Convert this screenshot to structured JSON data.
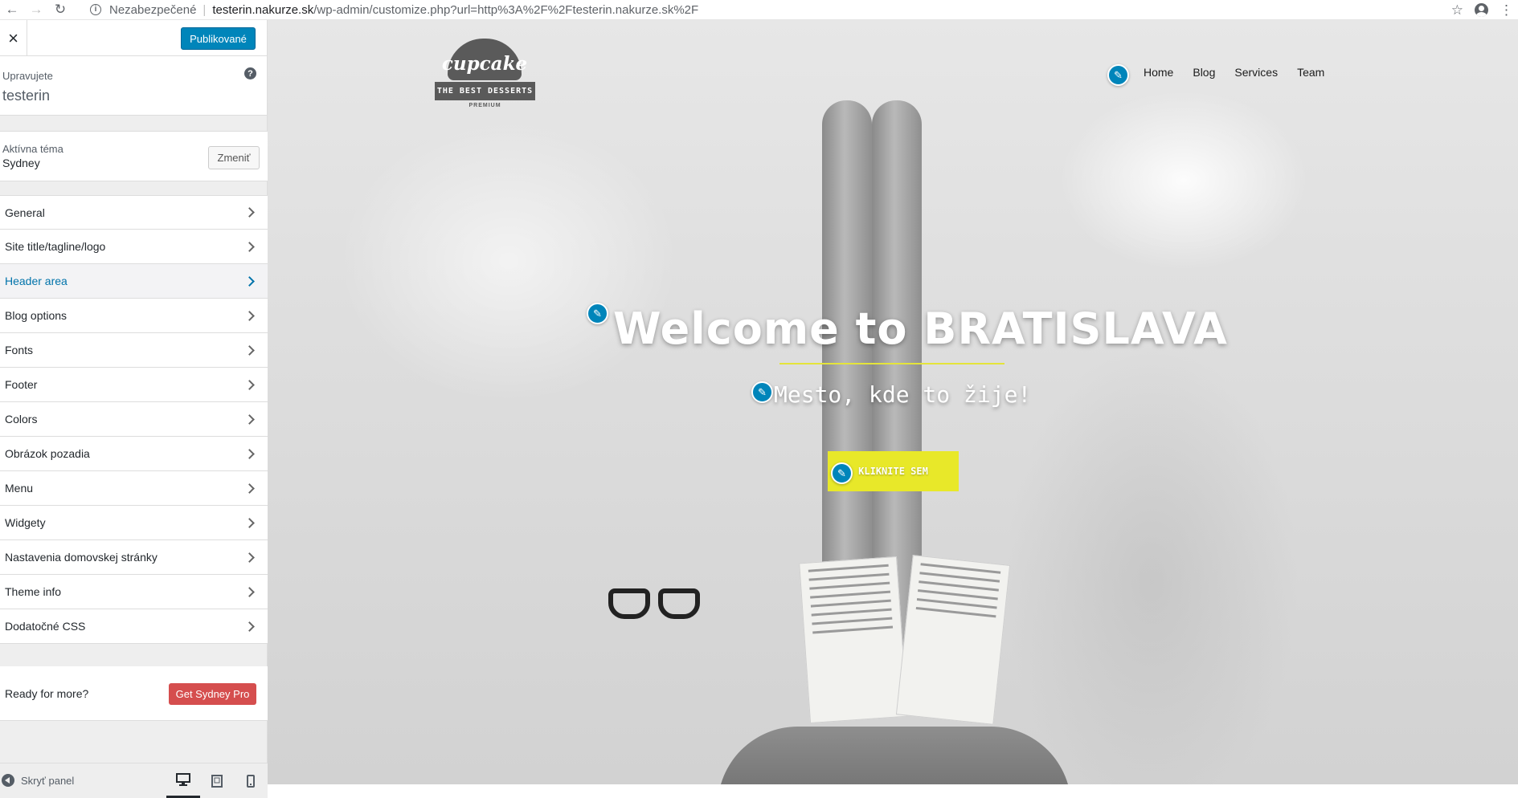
{
  "browser": {
    "security_label": "Nezabezpečené",
    "url_domain": "testerin.nakurze.sk",
    "url_path": "/wp-admin/customize.php?url=http%3A%2F%2Ftesterin.nakurze.sk%2F"
  },
  "customizer": {
    "close_label": "×",
    "publish_label": "Publikované",
    "editing_label": "Upravujete",
    "site_name": "testerin",
    "help_label": "?",
    "theme_label": "Aktívna téma",
    "theme_name": "Sydney",
    "change_label": "Zmeniť",
    "menu": [
      {
        "label": "General"
      },
      {
        "label": "Site title/tagline/logo"
      },
      {
        "label": "Header area"
      },
      {
        "label": "Blog options"
      },
      {
        "label": "Fonts"
      },
      {
        "label": "Footer"
      },
      {
        "label": "Colors"
      },
      {
        "label": "Obrázok pozadia"
      },
      {
        "label": "Menu"
      },
      {
        "label": "Widgety"
      },
      {
        "label": "Nastavenia domovskej stránky"
      },
      {
        "label": "Theme info"
      },
      {
        "label": "Dodatočné CSS"
      }
    ],
    "active_item": "Header area",
    "upsell_text": "Ready for more?",
    "upsell_button": "Get Sydney Pro",
    "collapse_label": "Skryť panel"
  },
  "site": {
    "logo": {
      "script": "cupcake",
      "band": "THE BEST DESSERTS",
      "sub": "PREMIUM"
    },
    "nav": [
      "Home",
      "Blog",
      "Services",
      "Team"
    ],
    "hero_title": "Welcome to BRATISLAVA",
    "hero_subtitle": "Mesto, kde to žije!",
    "hero_button": "KLIKNITE SEM"
  },
  "colors": {
    "publish": "#0085ba",
    "active_menu": "#0073aa",
    "pro_button": "#d54e4e",
    "hero_button": "#e8e829",
    "hero_rule": "#e4e43a"
  },
  "icons": {
    "back": "arrow-left-icon",
    "forward": "arrow-right-icon",
    "reload": "reload-icon",
    "info": "info-icon",
    "star": "star-icon",
    "account": "account-icon",
    "menu": "kebab-menu-icon",
    "edit": "pencil-icon",
    "desktop": "desktop-icon",
    "tablet": "tablet-icon",
    "mobile": "mobile-icon"
  }
}
